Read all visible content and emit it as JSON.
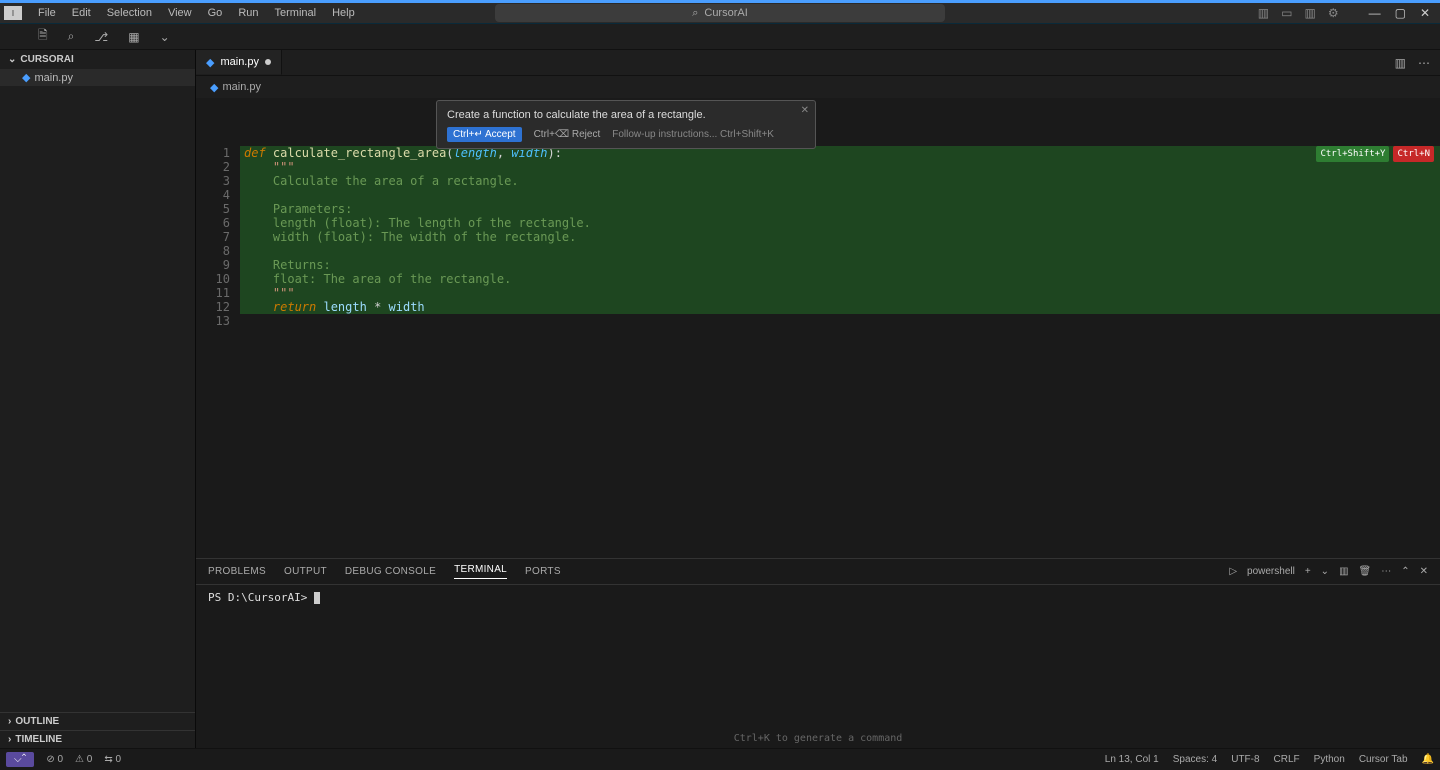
{
  "menubar": {
    "items": [
      "File",
      "Edit",
      "Selection",
      "View",
      "Go",
      "Run",
      "Terminal",
      "Help"
    ],
    "search_label": "CursorAI"
  },
  "sidebar": {
    "root_label": "CURSORAI",
    "file": "main.py",
    "outline": "OUTLINE",
    "timeline": "TIMELINE"
  },
  "tab": {
    "label": "main.py"
  },
  "breadcrumb": {
    "label": "main.py"
  },
  "ai_popup": {
    "prompt": "Create a function to calculate the area of a rectangle.",
    "accept": "Ctrl+↵ Accept",
    "reject": "Ctrl+⌫ Reject",
    "followup": "Follow-up instructions...  Ctrl+Shift+K"
  },
  "hints": {
    "accept_all": "Ctrl+Shift+Y",
    "reject_all": "Ctrl+N"
  },
  "code": {
    "lines": [
      {
        "n": 1,
        "tokens": [
          [
            "kw",
            "def "
          ],
          [
            "fn",
            "calculate_rectangle_area"
          ],
          [
            "op",
            "("
          ],
          [
            "param",
            "length"
          ],
          [
            "op",
            ", "
          ],
          [
            "param",
            "width"
          ],
          [
            "op",
            "):"
          ]
        ]
      },
      {
        "n": 2,
        "tokens": [
          [
            "op",
            "    "
          ],
          [
            "str",
            "\"\"\""
          ]
        ]
      },
      {
        "n": 3,
        "tokens": [
          [
            "op",
            "    "
          ],
          [
            "comm",
            "Calculate the area of a rectangle."
          ]
        ]
      },
      {
        "n": 4,
        "tokens": [
          [
            "op",
            "    "
          ]
        ]
      },
      {
        "n": 5,
        "tokens": [
          [
            "op",
            "    "
          ],
          [
            "comm",
            "Parameters:"
          ]
        ]
      },
      {
        "n": 6,
        "tokens": [
          [
            "op",
            "    "
          ],
          [
            "comm",
            "length (float): The length of the rectangle."
          ]
        ]
      },
      {
        "n": 7,
        "tokens": [
          [
            "op",
            "    "
          ],
          [
            "comm",
            "width (float): The width of the rectangle."
          ]
        ]
      },
      {
        "n": 8,
        "tokens": [
          [
            "op",
            "    "
          ]
        ]
      },
      {
        "n": 9,
        "tokens": [
          [
            "op",
            "    "
          ],
          [
            "comm",
            "Returns:"
          ]
        ]
      },
      {
        "n": 10,
        "tokens": [
          [
            "op",
            "    "
          ],
          [
            "comm",
            "float: The area of the rectangle."
          ]
        ]
      },
      {
        "n": 11,
        "tokens": [
          [
            "op",
            "    "
          ],
          [
            "str",
            "\"\"\""
          ]
        ]
      },
      {
        "n": 12,
        "tokens": [
          [
            "op",
            "    "
          ],
          [
            "ret",
            "return "
          ],
          [
            "ident",
            "length"
          ],
          [
            "op",
            " * "
          ],
          [
            "ident",
            "width"
          ]
        ]
      },
      {
        "n": 13,
        "blank": true
      }
    ]
  },
  "panel": {
    "tabs": [
      "PROBLEMS",
      "OUTPUT",
      "DEBUG CONSOLE",
      "TERMINAL",
      "PORTS"
    ],
    "active": "TERMINAL",
    "shell": "powershell",
    "prompt": "PS D:\\CursorAI> ",
    "hint": "Ctrl+K to generate a command"
  },
  "status": {
    "remote": "⌵⌃",
    "errors": "⊘ 0",
    "warnings": "⚠ 0",
    "ports": "⇆ 0",
    "ln": "Ln 13, Col 1",
    "spaces": "Spaces: 4",
    "encoding": "UTF-8",
    "eol": "CRLF",
    "lang": "Python",
    "cursor_tab": "Cursor Tab"
  }
}
